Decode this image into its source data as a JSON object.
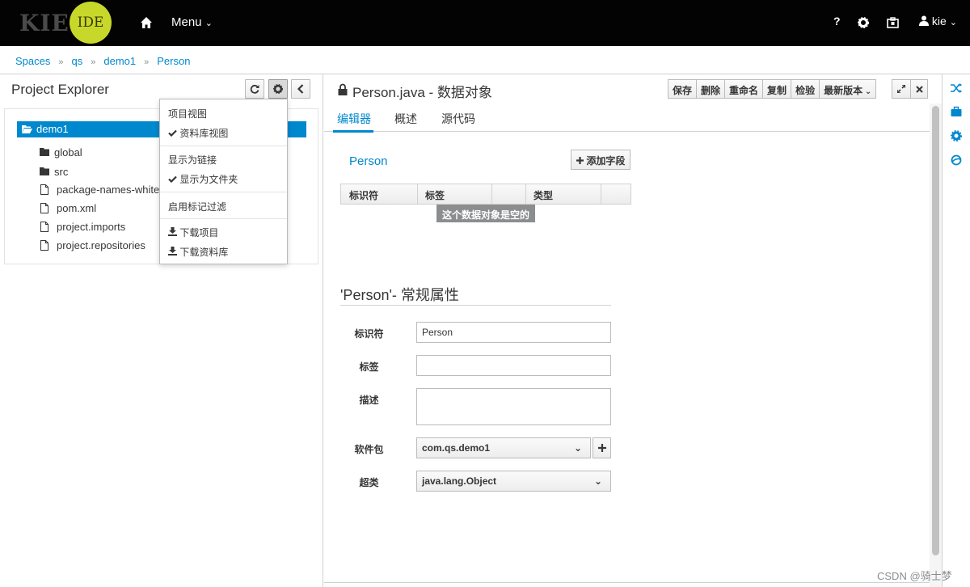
{
  "topbar": {
    "logo_kie": "KIE",
    "logo_ide": "IDE",
    "menu_label": "Menu",
    "help_label": "?",
    "user_label": "kie"
  },
  "breadcrumb": [
    "Spaces",
    "qs",
    "demo1",
    "Person"
  ],
  "left_panel": {
    "title": "Project Explorer",
    "tree_root": "demo1",
    "tree_items": [
      {
        "label": "global",
        "icon": "folder-icon"
      },
      {
        "label": "src",
        "icon": "folder-icon"
      },
      {
        "label": "package-names-white-",
        "icon": "file-icon"
      },
      {
        "label": "pom.xml",
        "icon": "file-icon"
      },
      {
        "label": "project.imports",
        "icon": "file-icon"
      },
      {
        "label": "project.repositories",
        "icon": "file-icon"
      }
    ]
  },
  "dropdown": {
    "items": [
      "项目视图",
      "资料库视图",
      "显示为链接",
      "显示为文件夹",
      "启用标记过滤",
      "下载项目",
      "下载资料库"
    ]
  },
  "editor": {
    "title": "Person.java - 数据对象",
    "toolbar": [
      "保存",
      "删除",
      "重命名",
      "复制",
      "检验",
      "最新版本"
    ],
    "tabs": [
      "编辑器",
      "概述",
      "源代码"
    ],
    "object_name": "Person",
    "add_field_label": "添加字段",
    "table_headers": [
      "标识符",
      "标签",
      "类型"
    ],
    "empty_message": "这个数据对象是空的",
    "props_heading": "'Person'- 常规属性",
    "form": {
      "identifier_label": "标识符",
      "identifier_value": "Person",
      "label_label": "标签",
      "label_value": "",
      "description_label": "描述",
      "description_value": "",
      "package_label": "软件包",
      "package_value": "com.qs.demo1",
      "superclass_label": "超类",
      "superclass_value": "java.lang.Object"
    }
  },
  "watermark": "CSDN @骑士梦",
  "colors": {
    "accent": "#0088ce",
    "topbar": "#030303",
    "logo_circle": "#c8d82a"
  }
}
